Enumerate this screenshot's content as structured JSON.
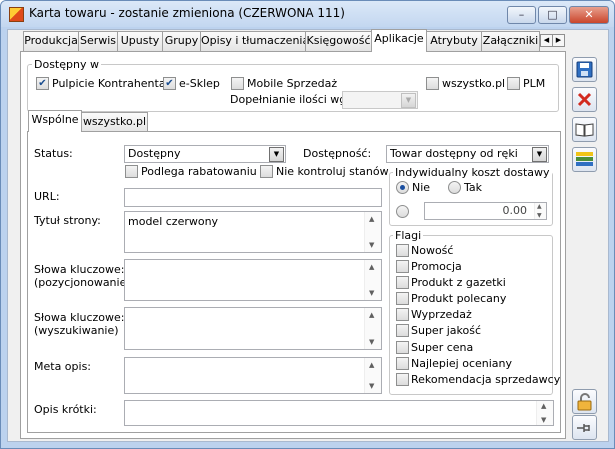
{
  "window": {
    "title": "Karta towaru - zostanie zmieniona (CZERWONA 111)",
    "minimize": "–",
    "maximize": "□",
    "close": "✕"
  },
  "tabs": [
    {
      "label": "Produkcja"
    },
    {
      "label": "Serwis"
    },
    {
      "label": "Upusty"
    },
    {
      "label": "Grupy"
    },
    {
      "label": "Opisy i tłumaczenia"
    },
    {
      "label": "Księgowość"
    },
    {
      "label": "Aplikacje"
    },
    {
      "label": "Atrybuty"
    },
    {
      "label": "Załączniki"
    }
  ],
  "tab_scroll": {
    "left": "◀",
    "right": "▶"
  },
  "dostepny": {
    "group_label": "Dostępny w",
    "pulpicie": {
      "label": "Pulpicie Kontrahenta",
      "checked": "✔"
    },
    "esklep": {
      "label": "e-Sklep",
      "checked": "✔"
    },
    "mobile": {
      "label": "Mobile Sprzedaż"
    },
    "wszystko": {
      "label": "wszystko.pl"
    },
    "plm": {
      "label": "PLM"
    },
    "dopelnianie_label": "Dopełnianie ilości wg:",
    "dopelnianie_value": ""
  },
  "subtabs": [
    {
      "label": "Wspólne"
    },
    {
      "label": "wszystko.pl"
    }
  ],
  "form": {
    "status_label": "Status:",
    "status_value": "Dostępny",
    "dostepnosc_label": "Dostępność:",
    "dostepnosc_value": "Towar dostępny od ręki",
    "podlega_label": "Podlega rabatowaniu",
    "nie_kontroluj_label": "Nie kontroluj stanów",
    "url_label": "URL:",
    "url_value": "",
    "tytul_label": "Tytuł strony:",
    "tytul_value": "model czerwony",
    "slowa_poz_label1": "Słowa kluczowe:",
    "slowa_poz_label2": "(pozycjonowanie)",
    "slowa_wysz_label1": "Słowa kluczowe:",
    "slowa_wysz_label2": "(wyszukiwanie)",
    "meta_label": "Meta opis:",
    "opis_label": "Opis krótki:"
  },
  "koszt": {
    "group_label": "Indywidualny koszt dostawy",
    "nie_label": "Nie",
    "tak_label": "Tak",
    "amount": "0.00"
  },
  "flagi": {
    "group_label": "Flagi",
    "items": [
      {
        "label": "Nowość"
      },
      {
        "label": "Promocja"
      },
      {
        "label": "Produkt z gazetki"
      },
      {
        "label": "Produkt polecany"
      },
      {
        "label": "Wyprzedaż"
      },
      {
        "label": "Super jakość"
      },
      {
        "label": "Super cena"
      },
      {
        "label": "Najlepiej oceniany"
      },
      {
        "label": "Rekomendacja sprzedawcy"
      }
    ]
  },
  "side_buttons": [
    "save-icon",
    "delete-icon",
    "book-icon",
    "list-icon",
    "lock-icon",
    "pin-icon"
  ]
}
